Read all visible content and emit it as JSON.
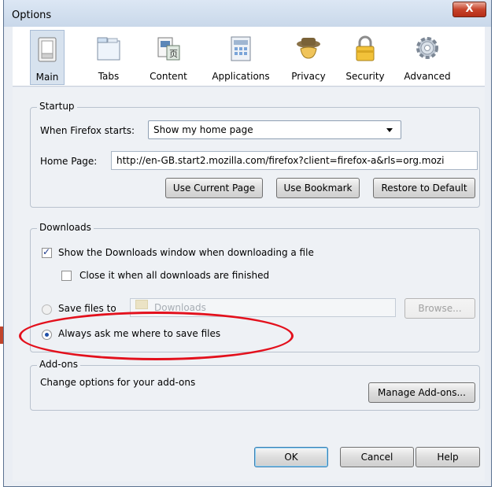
{
  "window": {
    "title": "Options",
    "close_label": "X"
  },
  "toolbar": {
    "items": [
      {
        "label": "Main",
        "icon": "switch-icon"
      },
      {
        "label": "Tabs",
        "icon": "tabs-icon"
      },
      {
        "label": "Content",
        "icon": "content-icon"
      },
      {
        "label": "Applications",
        "icon": "applications-icon"
      },
      {
        "label": "Privacy",
        "icon": "mask-icon"
      },
      {
        "label": "Security",
        "icon": "lock-icon"
      },
      {
        "label": "Advanced",
        "icon": "gear-icon"
      }
    ],
    "selected": "Main"
  },
  "startup": {
    "legend": "Startup",
    "when_label": "When Firefox starts:",
    "when_value": "Show my home page",
    "home_label": "Home Page:",
    "home_value": "http://en-GB.start2.mozilla.com/firefox?client=firefox-a&rls=org.mozi",
    "use_current_label": "Use Current Page",
    "use_bookmark_label": "Use Bookmark",
    "restore_label": "Restore to Default"
  },
  "downloads": {
    "legend": "Downloads",
    "show_window_label": "Show the Downloads window when downloading a file",
    "close_when_done_label": "Close it when all downloads are finished",
    "save_files_label": "Save files to",
    "save_folder_value": "Downloads",
    "browse_label": "Browse...",
    "always_ask_label": "Always ask me where to save files",
    "show_window_checked": true,
    "close_when_done_checked": false,
    "selected_option": "always_ask"
  },
  "addons": {
    "legend": "Add-ons",
    "description": "Change options for your add-ons",
    "manage_label": "Manage Add-ons..."
  },
  "footer": {
    "ok_label": "OK",
    "cancel_label": "Cancel",
    "help_label": "Help"
  },
  "colors": {
    "annotation": "#e3101c",
    "selected_tab": "#d7e2ee",
    "dialog_bg": "#eef1f5"
  }
}
